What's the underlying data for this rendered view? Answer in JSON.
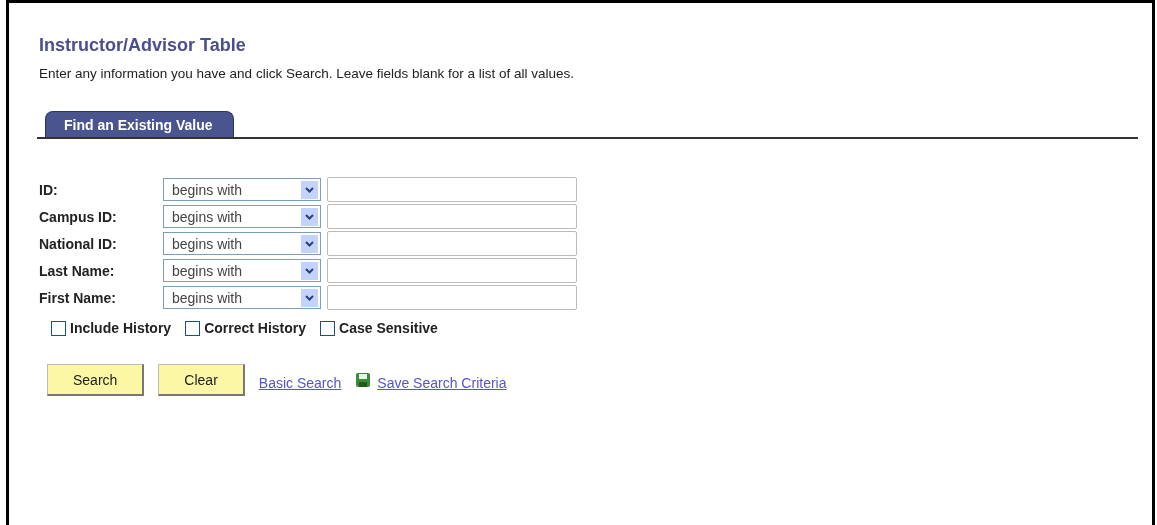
{
  "page": {
    "title": "Instructor/Advisor Table",
    "instructions": "Enter any information you have and click Search. Leave fields blank for a list of all values."
  },
  "tabs": [
    {
      "label": "Find an Existing Value",
      "selected": true
    }
  ],
  "criteria": [
    {
      "label": "ID:",
      "operator": "begins with"
    },
    {
      "label": "Campus ID:",
      "operator": "begins with"
    },
    {
      "label": "National ID:",
      "operator": "begins with"
    },
    {
      "label": "Last Name:",
      "operator": "begins with"
    },
    {
      "label": "First Name:",
      "operator": "begins with"
    }
  ],
  "options": [
    {
      "label": "Include History",
      "checked": false
    },
    {
      "label": "Correct History",
      "checked": false
    },
    {
      "label": "Case Sensitive",
      "checked": false
    }
  ],
  "buttons": [
    "Search",
    "Clear"
  ],
  "links": [
    {
      "label": "Basic Search",
      "kind": "plain"
    },
    {
      "label": "Save Search Criteria",
      "kind": "save"
    }
  ]
}
